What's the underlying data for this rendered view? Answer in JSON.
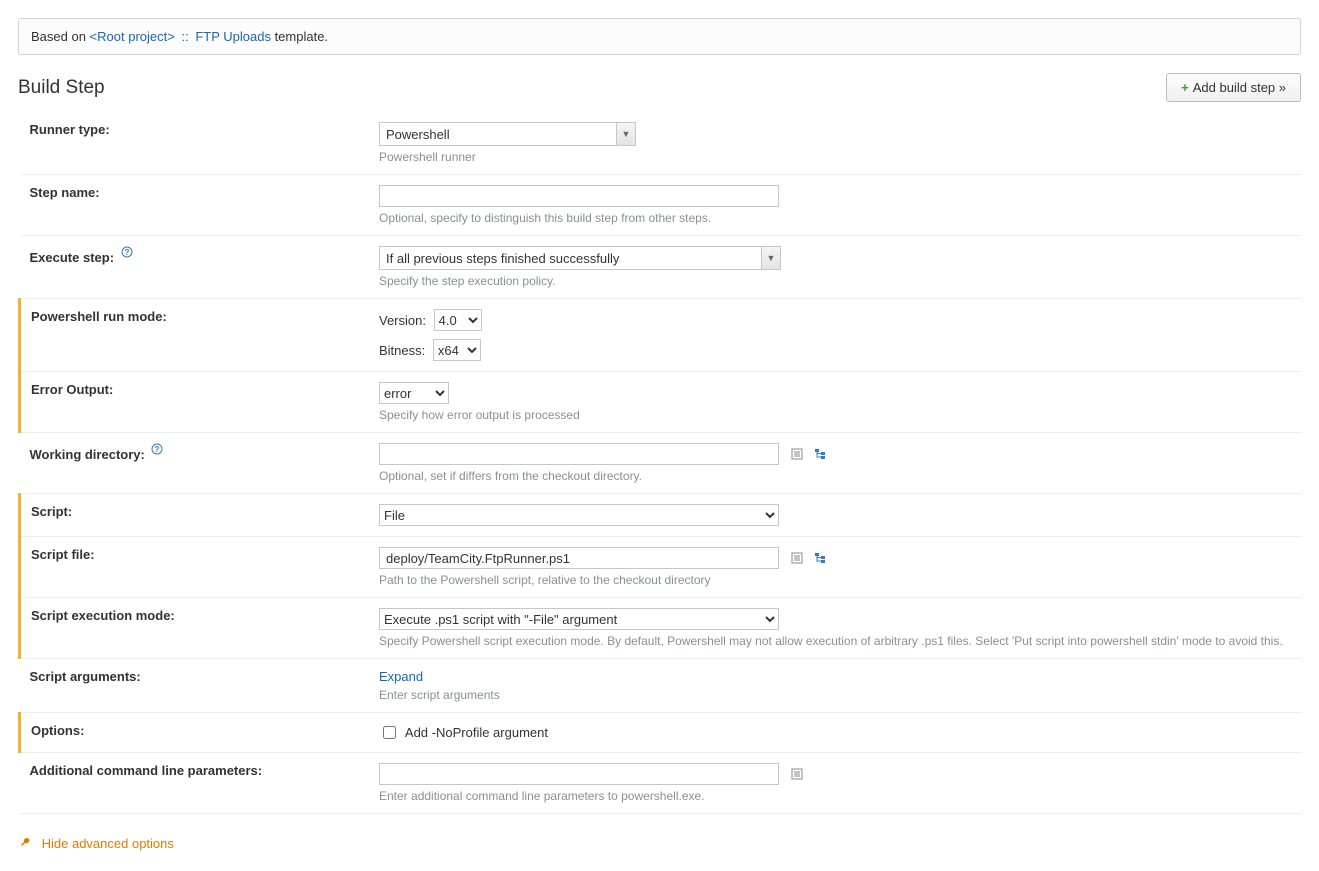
{
  "template_bar": {
    "prefix": "Based on ",
    "root_link": "<Root project>",
    "separator": "::",
    "template_link": "FTP Uploads",
    "suffix": " template."
  },
  "header": {
    "title": "Build Step",
    "add_button": "Add build step »"
  },
  "rows": {
    "runner_type": {
      "label": "Runner type:",
      "value": "Powershell",
      "hint": "Powershell runner"
    },
    "step_name": {
      "label": "Step name:",
      "value": "",
      "hint": "Optional, specify to distinguish this build step from other steps."
    },
    "execute_step": {
      "label": "Execute step:",
      "value": "If all previous steps finished successfully",
      "hint": "Specify the step execution policy."
    },
    "ps_run_mode": {
      "label": "Powershell run mode:",
      "version_label": "Version:",
      "version_value": "4.0",
      "bitness_label": "Bitness:",
      "bitness_value": "x64"
    },
    "error_output": {
      "label": "Error Output:",
      "value": "error",
      "hint": "Specify how error output is processed"
    },
    "working_dir": {
      "label": "Working directory:",
      "value": "",
      "hint": "Optional, set if differs from the checkout directory."
    },
    "script": {
      "label": "Script:",
      "value": "File"
    },
    "script_file": {
      "label": "Script file:",
      "value": "deploy/TeamCity.FtpRunner.ps1",
      "hint": "Path to the Powershell script, relative to the checkout directory"
    },
    "script_exec_mode": {
      "label": "Script execution mode:",
      "value": "Execute .ps1 script with \"-File\" argument",
      "hint": "Specify Powershell script execution mode. By default, Powershell may not allow execution of arbitrary .ps1 files. Select 'Put script into powershell stdin' mode to avoid this."
    },
    "script_args": {
      "label": "Script arguments:",
      "expand": "Expand",
      "hint": "Enter script arguments"
    },
    "options": {
      "label": "Options:",
      "checkbox_label": "Add -NoProfile argument"
    },
    "additional_params": {
      "label": "Additional command line parameters:",
      "value": "",
      "hint": "Enter additional command line parameters to powershell.exe."
    }
  },
  "footer": {
    "hide_advanced": "Hide advanced options"
  }
}
